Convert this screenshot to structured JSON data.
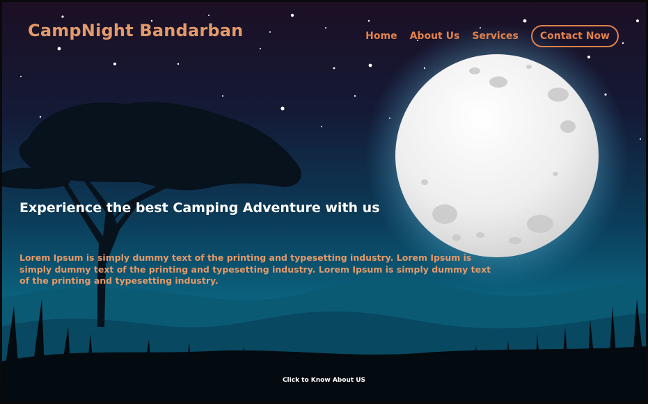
{
  "site": {
    "brand": "CampNight Bandarban"
  },
  "nav": {
    "items": [
      {
        "label": "Home"
      },
      {
        "label": "About Us"
      },
      {
        "label": "Services"
      }
    ],
    "contact_label": "Contact Now"
  },
  "hero": {
    "headline": "Experience the best Camping Adventure with us",
    "body": "Lorem Ipsum is simply dummy text of the printing and typesetting industry. Lorem Ipsum is simply dummy text of the printing and typesetting industry. Lorem Ipsum is simply dummy text of the printing and typesetting industry.",
    "cta": "Click to Know About US"
  },
  "colors": {
    "accent": "#e2814b",
    "brand": "#e39a6a",
    "sky_top": "#1c0f24",
    "sky_bottom": "#0b6a86"
  },
  "icons": {
    "moon": "full-moon-illustration",
    "tree": "acacia-tree-silhouette"
  }
}
